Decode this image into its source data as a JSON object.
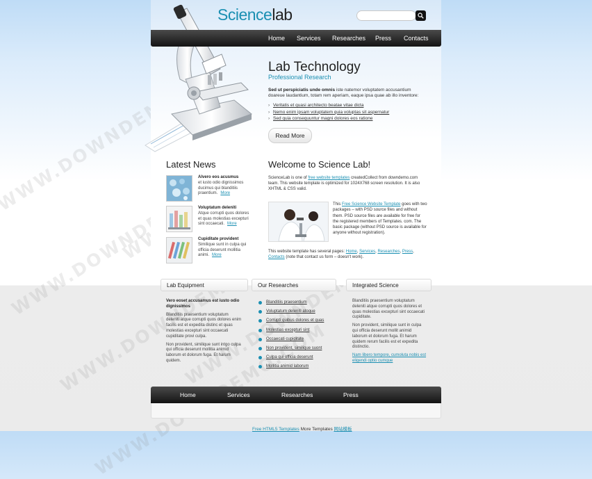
{
  "header": {
    "logo_part1": "Science",
    "logo_part2": "lab",
    "search_placeholder": ""
  },
  "nav": [
    "Home",
    "Services",
    "Researches",
    "Press",
    "Contacts"
  ],
  "hero": {
    "title": "Lab Technology",
    "subtitle": "Professional Research",
    "text_bold": "Sed ut perspiciatis unde omnis",
    "text_rest": " iste natemor voluptatem accusantium doareue laudantium, totam rem aperiam, eaque ipsa quae ab illo inventore:",
    "list": [
      "Veritatis et quasi architecto beatae vitae dicta",
      "Nemo enim ipsam voluptatem quia voluptas sit aspernatur",
      "Sed quia consequuntur magni dolores eos ratione"
    ],
    "button": "Read More"
  },
  "news": {
    "title": "Latest News",
    "items": [
      {
        "heading": "Alvero eos acusmus",
        "text": "et iusto odio dignissimos ducimus qui blanditiis praentium.",
        "more": "More"
      },
      {
        "heading": "Voluptatum deleniti",
        "text": "Atque corrupti quos dolores et quas molestias excepturi sint occaecati.",
        "more": "More"
      },
      {
        "heading": "Cupiditate provident",
        "text": "Similique sunt in culpa qui officia deserunt mollitia animi.",
        "more": "More"
      }
    ]
  },
  "welcome": {
    "title": "Welcome to Science Lab!",
    "p1_a": "ScienceLab is one of ",
    "p1_link": "free website templates",
    "p1_b": " createdCollect from downdemo.com team. This website template is optimized for 1024X768 screen resolution. It is also XHTML & CSS valid.",
    "p2_a": "This ",
    "p2_link": "Free Science Website Template",
    "p2_b": " goes with two packages – with PSD source files and without them. PSD source files are available for free for the registered members of Templates. com. The basic package (without PSD source is available for anyone without registration).",
    "p3_a": "This website template has several pages: ",
    "p3_links": [
      "Home",
      "Services",
      "Researches",
      "Press",
      "Contacts"
    ],
    "p3_b": " (note that contact us form – doesn't work)."
  },
  "columns": {
    "equipment": {
      "title": "Lab Equipment",
      "bold": "Vero eoset accusamus est iusto odio dignissimos",
      "p1": "Blanditiis praesentium voluptatum deleniti atque corrupti quos dolores enim facilis est et expedita distinc et quas molestias excepturi sint occaecati cupiditate provi culpa.",
      "p2": "Non provident, similique sunt intgo culpa qui officia deserunt mollitia animid laborum et dolorum fuga. Et harum quidem."
    },
    "researches": {
      "title": "Our Researches",
      "items": [
        "Blanditiis praesentium",
        "Voluptatum deleniti atoque",
        "Corrupti quibus dolores et quas",
        "Molestias excepturi sint",
        "Occaecati cupiditate",
        "Non provident, similique suont",
        "Culpa qui officia deserunt",
        "Mollitia animid laborum"
      ]
    },
    "integrated": {
      "title": "Integrated Science",
      "p1": "Blanditiis praesentium voluptatum deleniti atque corrupti quos dolores et quas molestias excepturi sint occaecati cupiditate.",
      "p2": "Non provident, similique sunt in culpa qui officia deserunt mollit animid laborum et dolorum fuga. Et harum quidem rerum facilis est et expedita distinctio.",
      "link": "Nam libero tempore, cumoluta nobis est eligendi optio cumque"
    }
  },
  "footer_nav": [
    "Home",
    "Services",
    "Researches",
    "Press"
  ],
  "credit": {
    "link1": "Free HTML5 Templates",
    "text": " More Templates ",
    "link2": "网站模板"
  },
  "watermark": "WWW.DOWNDEMO.COM",
  "colors": {
    "accent": "#1a8fb2",
    "nav_bg": "#1f1f1f"
  }
}
